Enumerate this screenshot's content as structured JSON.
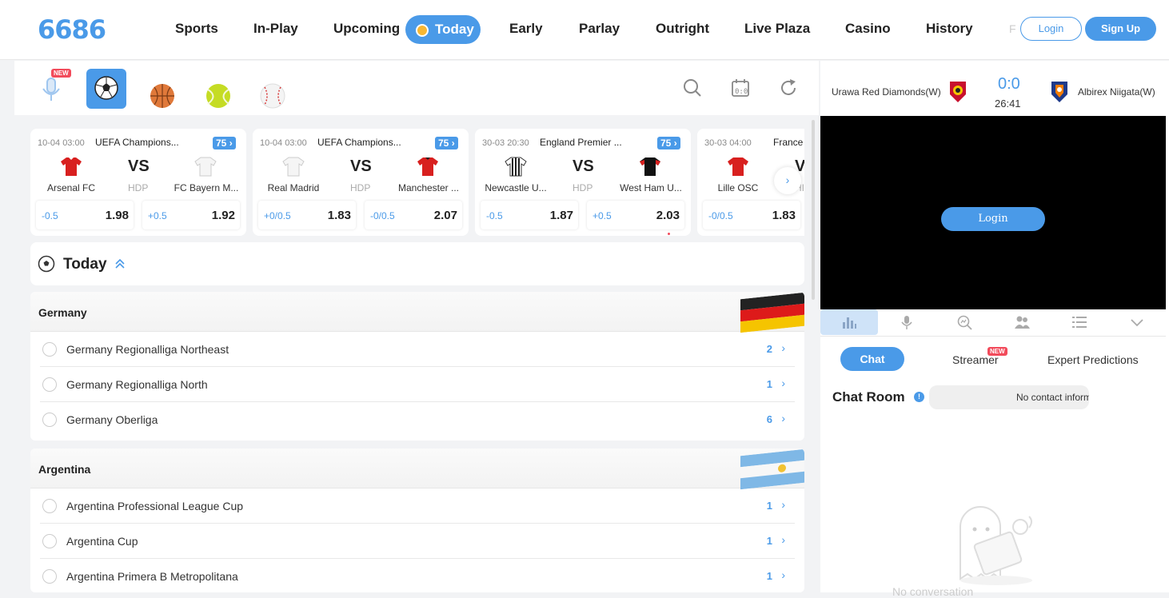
{
  "header": {
    "logo": "6686",
    "nav": [
      "Sports",
      "In-Play",
      "Upcoming",
      "Today",
      "Early",
      "Parlay",
      "Outright",
      "Live Plaza",
      "Casino",
      "History"
    ],
    "nav_overflow": "F",
    "login": "Login",
    "signup": "Sign Up"
  },
  "sports_bar": {
    "new_badge": "NEW",
    "items": [
      "microphone-icon",
      "soccer-ball-icon",
      "basketball-icon",
      "tennis-ball-icon",
      "baseball-icon"
    ],
    "tools": [
      "search-icon",
      "calendar-score-icon",
      "refresh-icon"
    ]
  },
  "match_cards": [
    {
      "time": "10-04 03:00",
      "league": "UEFA Champions...",
      "count": "75",
      "home": "Arsenal FC",
      "away": "FC Bayern M...",
      "vs": "VS",
      "hdp": "HDP",
      "home_hdp": "-0.5",
      "home_odd": "1.98",
      "away_hdp": "+0.5",
      "away_odd": "1.92"
    },
    {
      "time": "10-04 03:00",
      "league": "UEFA Champions...",
      "count": "75",
      "home": "Real Madrid",
      "away": "Manchester ...",
      "vs": "VS",
      "hdp": "HDP",
      "home_hdp": "+0/0.5",
      "home_odd": "1.83",
      "away_hdp": "-0/0.5",
      "away_odd": "2.07"
    },
    {
      "time": "30-03 20:30",
      "league": "England Premier ...",
      "count": "75",
      "home": "Newcastle U...",
      "away": "West Ham U...",
      "vs": "VS",
      "hdp": "HDP",
      "home_hdp": "-0.5",
      "home_odd": "1.87",
      "away_hdp": "+0.5",
      "away_odd": "2.03"
    },
    {
      "time": "30-03 04:00",
      "league": "France",
      "count": "",
      "home": "Lille OSC",
      "away": "",
      "vs": "V",
      "hdp": "HI",
      "home_hdp": "-0/0.5",
      "home_odd": "1.83",
      "away_hdp": "",
      "away_odd": ""
    }
  ],
  "today": {
    "title": "Today"
  },
  "countries": [
    {
      "name": "Germany",
      "leagues": [
        {
          "name": "Germany Regionalliga Northeast",
          "count": "2"
        },
        {
          "name": "Germany Regionalliga North",
          "count": "1"
        },
        {
          "name": "Germany Oberliga",
          "count": "6"
        }
      ]
    },
    {
      "name": "Argentina",
      "leagues": [
        {
          "name": "Argentina Professional League Cup",
          "count": "1"
        },
        {
          "name": "Argentina Cup",
          "count": "1"
        },
        {
          "name": "Argentina Primera B Metropolitana",
          "count": "1"
        }
      ]
    }
  ],
  "live": {
    "home": "Urawa Red Diamonds(W)",
    "away": "Albirex Niigata(W)",
    "score": "0:0",
    "clock": "26:41",
    "video_login": "Login"
  },
  "chat": {
    "tabs": [
      "Chat",
      "Streamer",
      "Expert Predictions"
    ],
    "streamer_new": "NEW",
    "room_title": "Chat Room",
    "contact": "No contact inform",
    "empty": "No conversation"
  },
  "colors": {
    "accent": "#4a9ae8",
    "badge": "#f24b5b"
  }
}
